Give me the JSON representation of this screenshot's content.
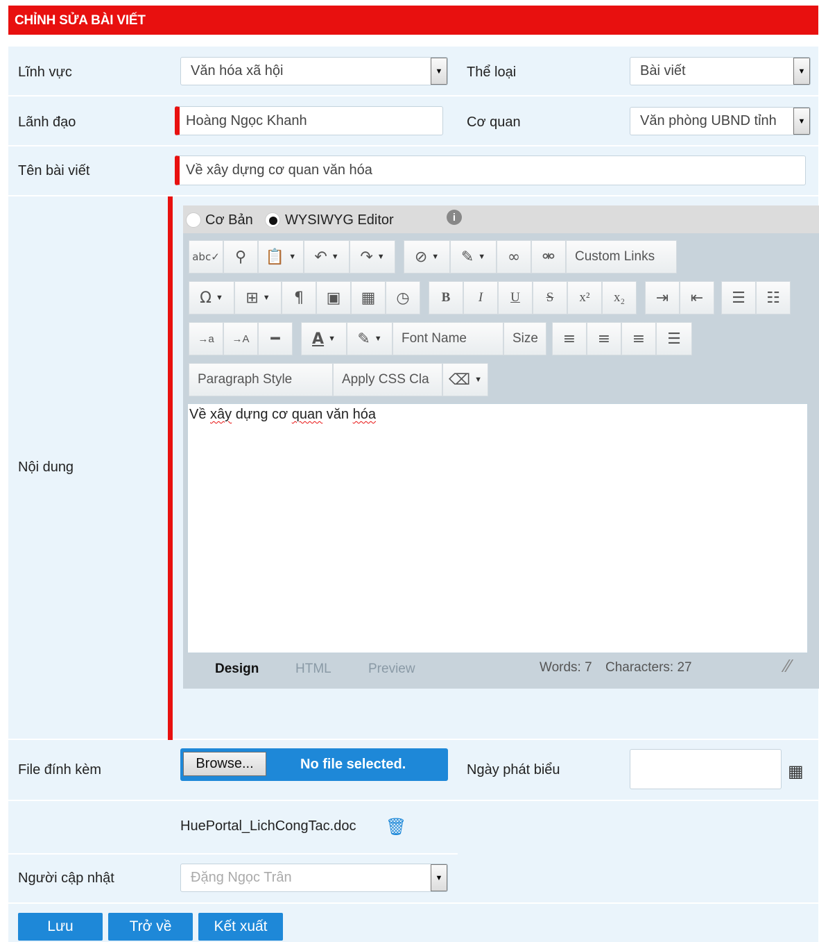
{
  "header": {
    "title": "CHỈNH SỬA BÀI VIẾT"
  },
  "colors": {
    "accent": "#e8100f",
    "primary": "#1e88d8",
    "form_bg": "#eaf4fb"
  },
  "fields": {
    "linh_vuc": {
      "label": "Lĩnh vực",
      "value": "Văn hóa xã hội"
    },
    "the_loai": {
      "label": "Thể loại",
      "value": "Bài viết"
    },
    "lanh_dao": {
      "label": "Lãnh đạo",
      "value": "Hoàng Ngọc Khanh"
    },
    "co_quan": {
      "label": "Cơ quan",
      "value": "Văn phòng UBND tỉnh"
    },
    "ten_bai_viet": {
      "label": "Tên bài viết",
      "value": "Về xây dựng cơ quan văn hóa"
    },
    "noi_dung": {
      "label": "Nội dung"
    },
    "file_dinh_kem": {
      "label": "File đính kèm",
      "browse_label": "Browse...",
      "status": "No file selected."
    },
    "ngay_phat_bieu": {
      "label": "Ngày phát biểu",
      "value": ""
    },
    "attached_file": {
      "name": "HuePortal_LichCongTac.doc"
    },
    "nguoi_cap_nhat": {
      "label": "Người cập nhật",
      "value": "Đặng Ngọc Trân"
    }
  },
  "editor": {
    "mode_basic": "Cơ Bản",
    "mode_wysiwyg": "WYSIWYG Editor",
    "custom_links": "Custom Links",
    "font_name": "Font Name",
    "size": "Size",
    "paragraph_style": "Paragraph Style",
    "apply_css": "Apply CSS Cla",
    "content_words": [
      "Về",
      "xây",
      "dựng",
      "cơ",
      "quan",
      "văn",
      "hóa"
    ],
    "tabs": {
      "design": "Design",
      "html": "HTML",
      "preview": "Preview"
    },
    "words": "Words: 7",
    "characters": "Characters: 27",
    "toolbar_icons": [
      "spellcheck-icon",
      "find-icon",
      "paste-icon",
      "undo-icon",
      "redo-icon",
      "attach-icon",
      "edit-icon",
      "link-icon",
      "unlink-icon",
      "symbol-icon",
      "table-icon",
      "paragraph-mark-icon",
      "image-icon",
      "date-icon",
      "time-icon",
      "bold-icon",
      "italic-icon",
      "underline-icon",
      "strike-icon",
      "superscript-icon",
      "subscript-icon",
      "indent-icon",
      "outdent-icon",
      "ordered-list-icon",
      "unordered-list-icon"
    ]
  },
  "actions": {
    "save": "Lưu",
    "back": "Trở về",
    "export": "Kết xuất"
  }
}
